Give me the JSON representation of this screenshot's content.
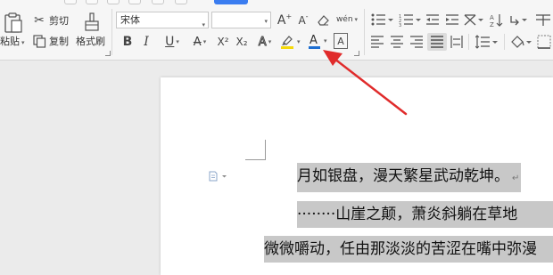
{
  "clipboard": {
    "paste_label": "粘贴",
    "cut_label": "剪切",
    "copy_label": "复制",
    "format_painter_label": "格式刷"
  },
  "font": {
    "family_value": "宋体",
    "size_value": ""
  },
  "font_tools": {
    "grow_font": "A",
    "shrink_font": "A",
    "pinyin_guide": "wén",
    "bold": "B",
    "italic": "I",
    "underline": "U",
    "strikethrough": "A",
    "superscript": "X²",
    "subscript": "X₂",
    "text_effect": "A",
    "font_color": "A",
    "char_border": "A"
  },
  "colors": {
    "highlight_color": "#f5d90a",
    "font_color_bar": "#1f6fd1",
    "arrow_color": "#e02b2b",
    "selection_highlight": "#c8c8c8"
  },
  "document": {
    "line1": "月如银盘，漫天繁星武动乾坤。",
    "line2": "········山崖之颠，萧炎斜躺在草地",
    "line3": "微微嚼动，任由那淡淡的苦涩在嘴中弥漫",
    "para_mark": "↵"
  }
}
